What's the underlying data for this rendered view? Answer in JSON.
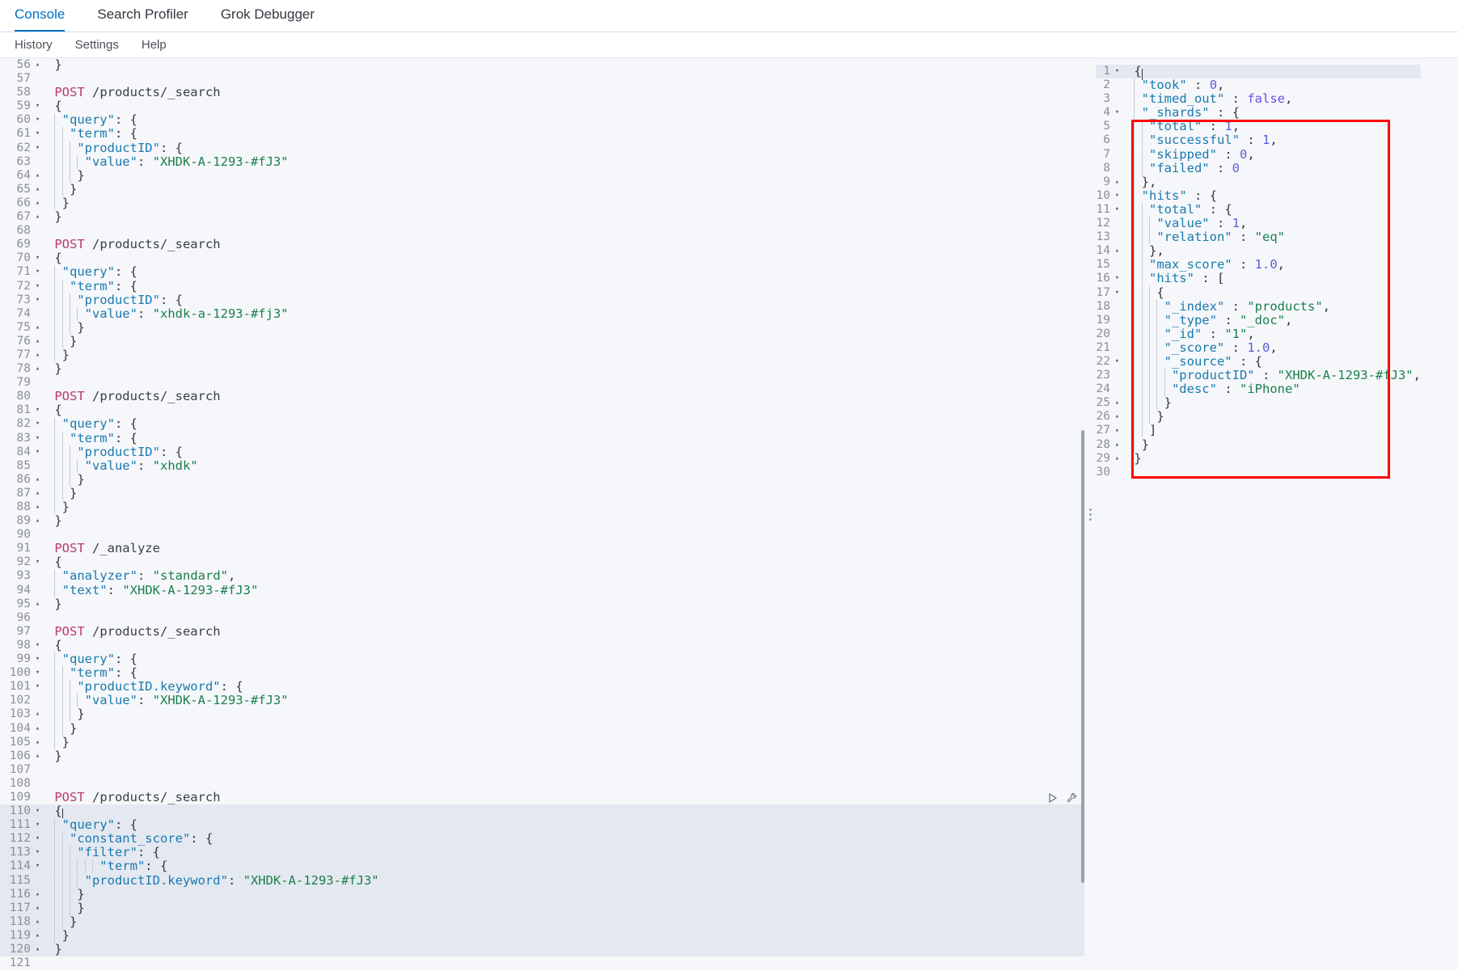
{
  "top_tabs": [
    {
      "label": "Console",
      "active": true
    },
    {
      "label": "Search Profiler",
      "active": false
    },
    {
      "label": "Grok Debugger",
      "active": false
    }
  ],
  "sub_menu": [
    {
      "label": "History"
    },
    {
      "label": "Settings"
    },
    {
      "label": "Help"
    }
  ],
  "colors": {
    "accent": "#0071c2",
    "annotation": "#ff0000",
    "method": "#bd3a6a",
    "key": "#1a7aae",
    "string": "#1a7f4b",
    "number": "#5e5bd8",
    "boolean": "#6b4ee6",
    "background": "#f5f7fa",
    "highlight_line": "#e4e8f1"
  },
  "editor": {
    "first_visible_line": 56,
    "cursor_line": 110,
    "actions": {
      "play_label": "play-triangle",
      "wrench_label": "wrench"
    },
    "lines": [
      {
        "n": 56,
        "fold": "up",
        "indent": 0,
        "text": "}"
      },
      {
        "n": 57,
        "fold": "",
        "indent": 0,
        "text": ""
      },
      {
        "n": 58,
        "fold": "",
        "indent": 0,
        "text": "POST /products/_search",
        "kind": "request",
        "method": "POST",
        "url": "/products/_search"
      },
      {
        "n": 59,
        "fold": "down",
        "indent": 0,
        "text": "{"
      },
      {
        "n": 60,
        "fold": "down",
        "indent": 1,
        "text": "\"query\": {"
      },
      {
        "n": 61,
        "fold": "down",
        "indent": 2,
        "text": "\"term\": {"
      },
      {
        "n": 62,
        "fold": "down",
        "indent": 3,
        "text": "\"productID\": {"
      },
      {
        "n": 63,
        "fold": "",
        "indent": 4,
        "text": "\"value\": \"XHDK-A-1293-#fJ3\""
      },
      {
        "n": 64,
        "fold": "up",
        "indent": 3,
        "text": "}"
      },
      {
        "n": 65,
        "fold": "up",
        "indent": 2,
        "text": "}"
      },
      {
        "n": 66,
        "fold": "up",
        "indent": 1,
        "text": "}"
      },
      {
        "n": 67,
        "fold": "up",
        "indent": 0,
        "text": "}"
      },
      {
        "n": 68,
        "fold": "",
        "indent": 0,
        "text": ""
      },
      {
        "n": 69,
        "fold": "",
        "indent": 0,
        "text": "POST /products/_search",
        "kind": "request",
        "method": "POST",
        "url": "/products/_search"
      },
      {
        "n": 70,
        "fold": "down",
        "indent": 0,
        "text": "{"
      },
      {
        "n": 71,
        "fold": "down",
        "indent": 1,
        "text": "\"query\": {"
      },
      {
        "n": 72,
        "fold": "down",
        "indent": 2,
        "text": "\"term\": {"
      },
      {
        "n": 73,
        "fold": "down",
        "indent": 3,
        "text": "\"productID\": {"
      },
      {
        "n": 74,
        "fold": "",
        "indent": 4,
        "text": "\"value\": \"xhdk-a-1293-#fj3\""
      },
      {
        "n": 75,
        "fold": "up",
        "indent": 3,
        "text": "}"
      },
      {
        "n": 76,
        "fold": "up",
        "indent": 2,
        "text": "}"
      },
      {
        "n": 77,
        "fold": "up",
        "indent": 1,
        "text": "}"
      },
      {
        "n": 78,
        "fold": "up",
        "indent": 0,
        "text": "}"
      },
      {
        "n": 79,
        "fold": "",
        "indent": 0,
        "text": ""
      },
      {
        "n": 80,
        "fold": "",
        "indent": 0,
        "text": "POST /products/_search",
        "kind": "request",
        "method": "POST",
        "url": "/products/_search"
      },
      {
        "n": 81,
        "fold": "down",
        "indent": 0,
        "text": "{"
      },
      {
        "n": 82,
        "fold": "down",
        "indent": 1,
        "text": "\"query\": {"
      },
      {
        "n": 83,
        "fold": "down",
        "indent": 2,
        "text": "\"term\": {"
      },
      {
        "n": 84,
        "fold": "down",
        "indent": 3,
        "text": "\"productID\": {"
      },
      {
        "n": 85,
        "fold": "",
        "indent": 4,
        "text": "\"value\": \"xhdk\""
      },
      {
        "n": 86,
        "fold": "up",
        "indent": 3,
        "text": "}"
      },
      {
        "n": 87,
        "fold": "up",
        "indent": 2,
        "text": "}"
      },
      {
        "n": 88,
        "fold": "up",
        "indent": 1,
        "text": "}"
      },
      {
        "n": 89,
        "fold": "up",
        "indent": 0,
        "text": "}"
      },
      {
        "n": 90,
        "fold": "",
        "indent": 0,
        "text": ""
      },
      {
        "n": 91,
        "fold": "",
        "indent": 0,
        "text": "POST /_analyze",
        "kind": "request",
        "method": "POST",
        "url": "/_analyze"
      },
      {
        "n": 92,
        "fold": "down",
        "indent": 0,
        "text": "{"
      },
      {
        "n": 93,
        "fold": "",
        "indent": 1,
        "text": "\"analyzer\": \"standard\","
      },
      {
        "n": 94,
        "fold": "",
        "indent": 1,
        "text": "\"text\": \"XHDK-A-1293-#fJ3\""
      },
      {
        "n": 95,
        "fold": "up",
        "indent": 0,
        "text": "}"
      },
      {
        "n": 96,
        "fold": "",
        "indent": 0,
        "text": ""
      },
      {
        "n": 97,
        "fold": "",
        "indent": 0,
        "text": "POST /products/_search",
        "kind": "request",
        "method": "POST",
        "url": "/products/_search"
      },
      {
        "n": 98,
        "fold": "down",
        "indent": 0,
        "text": "{"
      },
      {
        "n": 99,
        "fold": "down",
        "indent": 1,
        "text": "\"query\": {"
      },
      {
        "n": 100,
        "fold": "down",
        "indent": 2,
        "text": "\"term\": {"
      },
      {
        "n": 101,
        "fold": "down",
        "indent": 3,
        "text": "\"productID.keyword\": {"
      },
      {
        "n": 102,
        "fold": "",
        "indent": 4,
        "text": "\"value\": \"XHDK-A-1293-#fJ3\""
      },
      {
        "n": 103,
        "fold": "up",
        "indent": 3,
        "text": "}"
      },
      {
        "n": 104,
        "fold": "up",
        "indent": 2,
        "text": "}"
      },
      {
        "n": 105,
        "fold": "up",
        "indent": 1,
        "text": "}"
      },
      {
        "n": 106,
        "fold": "up",
        "indent": 0,
        "text": "}"
      },
      {
        "n": 107,
        "fold": "",
        "indent": 0,
        "text": ""
      },
      {
        "n": 108,
        "fold": "",
        "indent": 0,
        "text": ""
      },
      {
        "n": 109,
        "fold": "",
        "indent": 0,
        "text": "POST /products/_search",
        "kind": "request",
        "method": "POST",
        "url": "/products/_search",
        "has_actions": true
      },
      {
        "n": 110,
        "fold": "down",
        "indent": 0,
        "text": "{",
        "cursor": true,
        "selected": true
      },
      {
        "n": 111,
        "fold": "down",
        "indent": 1,
        "text": "\"query\": {",
        "selected": true
      },
      {
        "n": 112,
        "fold": "down",
        "indent": 2,
        "text": "\"constant_score\": {",
        "selected": true
      },
      {
        "n": 113,
        "fold": "down",
        "indent": 3,
        "text": "\"filter\": {",
        "selected": true
      },
      {
        "n": 114,
        "fold": "down",
        "indent": 6,
        "text": "\"term\": {",
        "selected": true
      },
      {
        "n": 115,
        "fold": "",
        "indent": 4,
        "text": "\"productID.keyword\": \"XHDK-A-1293-#fJ3\"",
        "selected": true
      },
      {
        "n": 116,
        "fold": "up",
        "indent": 3,
        "text": "}",
        "selected": true
      },
      {
        "n": 117,
        "fold": "up",
        "indent": 3,
        "text": "}",
        "selected": true
      },
      {
        "n": 118,
        "fold": "up",
        "indent": 2,
        "text": "}",
        "selected": true
      },
      {
        "n": 119,
        "fold": "up",
        "indent": 1,
        "text": "}",
        "selected": true
      },
      {
        "n": 120,
        "fold": "up",
        "indent": 0,
        "text": "}",
        "selected": true
      },
      {
        "n": 121,
        "fold": "",
        "indent": 0,
        "text": ""
      }
    ]
  },
  "response": {
    "lines": [
      {
        "n": 1,
        "fold": "down",
        "indent": 0,
        "text": "{",
        "highlight": true,
        "cursor": true
      },
      {
        "n": 2,
        "fold": "",
        "indent": 1,
        "text": "\"took\" : 0,"
      },
      {
        "n": 3,
        "fold": "",
        "indent": 1,
        "text": "\"timed_out\" : false,"
      },
      {
        "n": 4,
        "fold": "down",
        "indent": 1,
        "text": "\"_shards\" : {"
      },
      {
        "n": 5,
        "fold": "",
        "indent": 2,
        "text": "\"total\" : 1,"
      },
      {
        "n": 6,
        "fold": "",
        "indent": 2,
        "text": "\"successful\" : 1,"
      },
      {
        "n": 7,
        "fold": "",
        "indent": 2,
        "text": "\"skipped\" : 0,"
      },
      {
        "n": 8,
        "fold": "",
        "indent": 2,
        "text": "\"failed\" : 0"
      },
      {
        "n": 9,
        "fold": "up",
        "indent": 1,
        "text": "},"
      },
      {
        "n": 10,
        "fold": "down",
        "indent": 1,
        "text": "\"hits\" : {"
      },
      {
        "n": 11,
        "fold": "down",
        "indent": 2,
        "text": "\"total\" : {"
      },
      {
        "n": 12,
        "fold": "",
        "indent": 3,
        "text": "\"value\" : 1,"
      },
      {
        "n": 13,
        "fold": "",
        "indent": 3,
        "text": "\"relation\" : \"eq\""
      },
      {
        "n": 14,
        "fold": "up",
        "indent": 2,
        "text": "},"
      },
      {
        "n": 15,
        "fold": "",
        "indent": 2,
        "text": "\"max_score\" : 1.0,"
      },
      {
        "n": 16,
        "fold": "down",
        "indent": 2,
        "text": "\"hits\" : ["
      },
      {
        "n": 17,
        "fold": "down",
        "indent": 3,
        "text": "{"
      },
      {
        "n": 18,
        "fold": "",
        "indent": 4,
        "text": "\"_index\" : \"products\","
      },
      {
        "n": 19,
        "fold": "",
        "indent": 4,
        "text": "\"_type\" : \"_doc\","
      },
      {
        "n": 20,
        "fold": "",
        "indent": 4,
        "text": "\"_id\" : \"1\","
      },
      {
        "n": 21,
        "fold": "",
        "indent": 4,
        "text": "\"_score\" : 1.0,"
      },
      {
        "n": 22,
        "fold": "down",
        "indent": 4,
        "text": "\"_source\" : {"
      },
      {
        "n": 23,
        "fold": "",
        "indent": 5,
        "text": "\"productID\" : \"XHDK-A-1293-#fJ3\","
      },
      {
        "n": 24,
        "fold": "",
        "indent": 5,
        "text": "\"desc\" : \"iPhone\""
      },
      {
        "n": 25,
        "fold": "up",
        "indent": 4,
        "text": "}"
      },
      {
        "n": 26,
        "fold": "up",
        "indent": 3,
        "text": "}"
      },
      {
        "n": 27,
        "fold": "up",
        "indent": 2,
        "text": "]"
      },
      {
        "n": 28,
        "fold": "up",
        "indent": 1,
        "text": "}"
      },
      {
        "n": 29,
        "fold": "up",
        "indent": 0,
        "text": "}"
      },
      {
        "n": 30,
        "fold": "",
        "indent": 0,
        "text": ""
      }
    ]
  }
}
